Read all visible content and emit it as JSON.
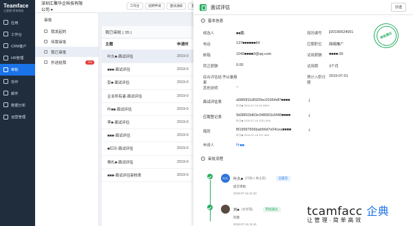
{
  "brand": {
    "name": "Teamface",
    "tagline": "让管理·简单高效"
  },
  "nav": [
    {
      "label": "应用",
      "icon": "grid-icon"
    },
    {
      "label": "工作台",
      "icon": "desk-icon"
    },
    {
      "label": "CRM客户",
      "icon": "user-icon"
    },
    {
      "label": "HR管理",
      "icon": "team-icon"
    },
    {
      "label": "审批",
      "icon": "approve-icon",
      "active": true
    },
    {
      "label": "协作",
      "icon": "collab-icon"
    },
    {
      "label": "邮件",
      "icon": "mail-icon"
    },
    {
      "label": "数据分析",
      "icon": "chart-icon"
    },
    {
      "label": "运营管理",
      "icon": "ops-icon"
    }
  ],
  "topbar": {
    "company": "深圳汇聚华企科技有限公司",
    "tabs": [
      "工作台",
      "招聘申请",
      "面试通知",
      "面"
    ]
  },
  "subnav": {
    "title": "审批",
    "items": [
      {
        "label": "我发起的"
      },
      {
        "label": "待我审批"
      },
      {
        "label": "我已审批",
        "active": true
      },
      {
        "label": "抄送给我",
        "badge": "294"
      }
    ]
  },
  "list": {
    "header": "我已审批 ( 35 )",
    "col_subject": "主题",
    "col_time": "申请时",
    "rows": [
      {
        "subject": "叶久■-面试评估",
        "time": "2019-0"
      },
      {
        "subject": "■■■-面试评估",
        "time": "2019-0"
      },
      {
        "subject": "彭■-面试评估",
        "time": "2019-0"
      },
      {
        "subject": "企业所有者-面试评估",
        "time": "2019-0"
      },
      {
        "subject": "叶■■-面试评估",
        "time": "2019-0"
      },
      {
        "subject": "李■-面试评估",
        "time": "2019-0"
      },
      {
        "subject": "■■■-面试评估",
        "time": "2019-0"
      },
      {
        "subject": "■红玲-面试评估",
        "time": "2019-0"
      },
      {
        "subject": "杨礼■-面试评估",
        "time": "2019-0"
      },
      {
        "subject": "■■■-面试评估审核表",
        "time": "2019-0"
      }
    ]
  },
  "panel": {
    "title": "面试评估",
    "copy": "抄送",
    "section_basic": "基本信息",
    "stamp_text": "审批通过",
    "fields_left": [
      {
        "k": "候选人",
        "v": "■■鹏"
      },
      {
        "k": "电话",
        "v": "137■■■■■■84"
      },
      {
        "k": "邮箱",
        "v": "1049■■■■3@qq.com"
      },
      {
        "k": "转正薪酬",
        "v": "0.00"
      },
      {
        "k": "综合评估结果",
        "v": "予以录用"
      },
      {
        "k": "其他说明",
        "v": "--"
      }
    ],
    "fields_right": [
      {
        "k": "简历编号",
        "v": "jl20190624001"
      },
      {
        "k": "应聘职位",
        "v": "网络推广"
      },
      {
        "k": "试用薪酬",
        "v": "■■■■.00"
      },
      {
        "k": "试用期",
        "v": "3个月"
      },
      {
        "k": "预计入职日期",
        "v": "2019-07-01"
      }
    ],
    "files": [
      {
        "k": "面试评估表",
        "name": "a5860f11d5920ec01564df7■■■■",
        "meta": "叶久■  2019-07-16  49.16Kb"
      },
      {
        "k": "应聘登记表",
        "name": "9d38603d63e348581b3448■■■■",
        "meta": "叶久■  2019-07-16  1021.4Kb"
      },
      {
        "k": "简历",
        "name": "f819997656bab56d7e04cea■■■■",
        "meta": "叶久■  2019-07-16  227.4Kb"
      }
    ],
    "applicant_key": "申请人",
    "applicant_val": "叶■■",
    "section_flow": "审批流程",
    "steps": [
      {
        "avatar": "叶久",
        "name": "叶久■",
        "role": "(行政人事主管)",
        "status": "已提交",
        "note": "提交审批",
        "time": "2019-07-16 11:40"
      },
      {
        "avatar": "",
        "name": "刘■",
        "role": "(总经理)",
        "status": "审批通过",
        "note": "同意",
        "time": "2019-07-16 11:44"
      }
    ]
  },
  "watermark": {
    "en": "tcamfacc",
    "cn": "企典",
    "slogan": "让管理·简单高效"
  },
  "colors": {
    "nav_bg": "#1f2d3d",
    "accent": "#1a73e8",
    "success": "#27ae60",
    "badge": "#e53935"
  }
}
